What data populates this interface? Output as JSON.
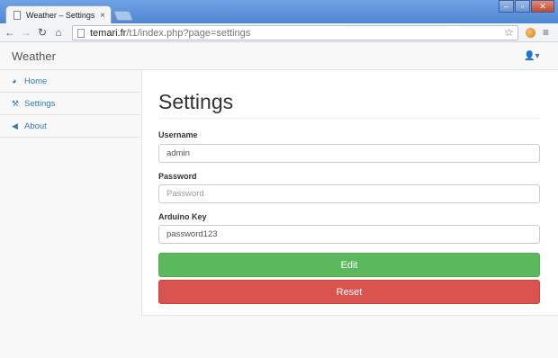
{
  "browser": {
    "tab_title": "Weather – Settings",
    "tab_close": "×",
    "url_host": "temari.fr",
    "url_path": "/t1/index.php?page=settings"
  },
  "navbar": {
    "brand": "Weather",
    "user_menu_label": "▾"
  },
  "sidebar": {
    "items": [
      {
        "label": "Home",
        "icon": "dashboard-icon"
      },
      {
        "label": "Settings",
        "icon": "wrench-icon"
      },
      {
        "label": "About",
        "icon": "bullhorn-icon"
      }
    ]
  },
  "main": {
    "title": "Settings",
    "form": {
      "username": {
        "label": "Username",
        "value": "admin",
        "placeholder": ""
      },
      "password": {
        "label": "Password",
        "value": "",
        "placeholder": "Password"
      },
      "arduino_key": {
        "label": "Arduino Key",
        "value": "password123",
        "placeholder": ""
      }
    },
    "buttons": {
      "edit": "Edit",
      "reset": "Reset"
    }
  },
  "colors": {
    "link": "#337ab7",
    "success": "#5cb85c",
    "danger": "#d9534f"
  }
}
